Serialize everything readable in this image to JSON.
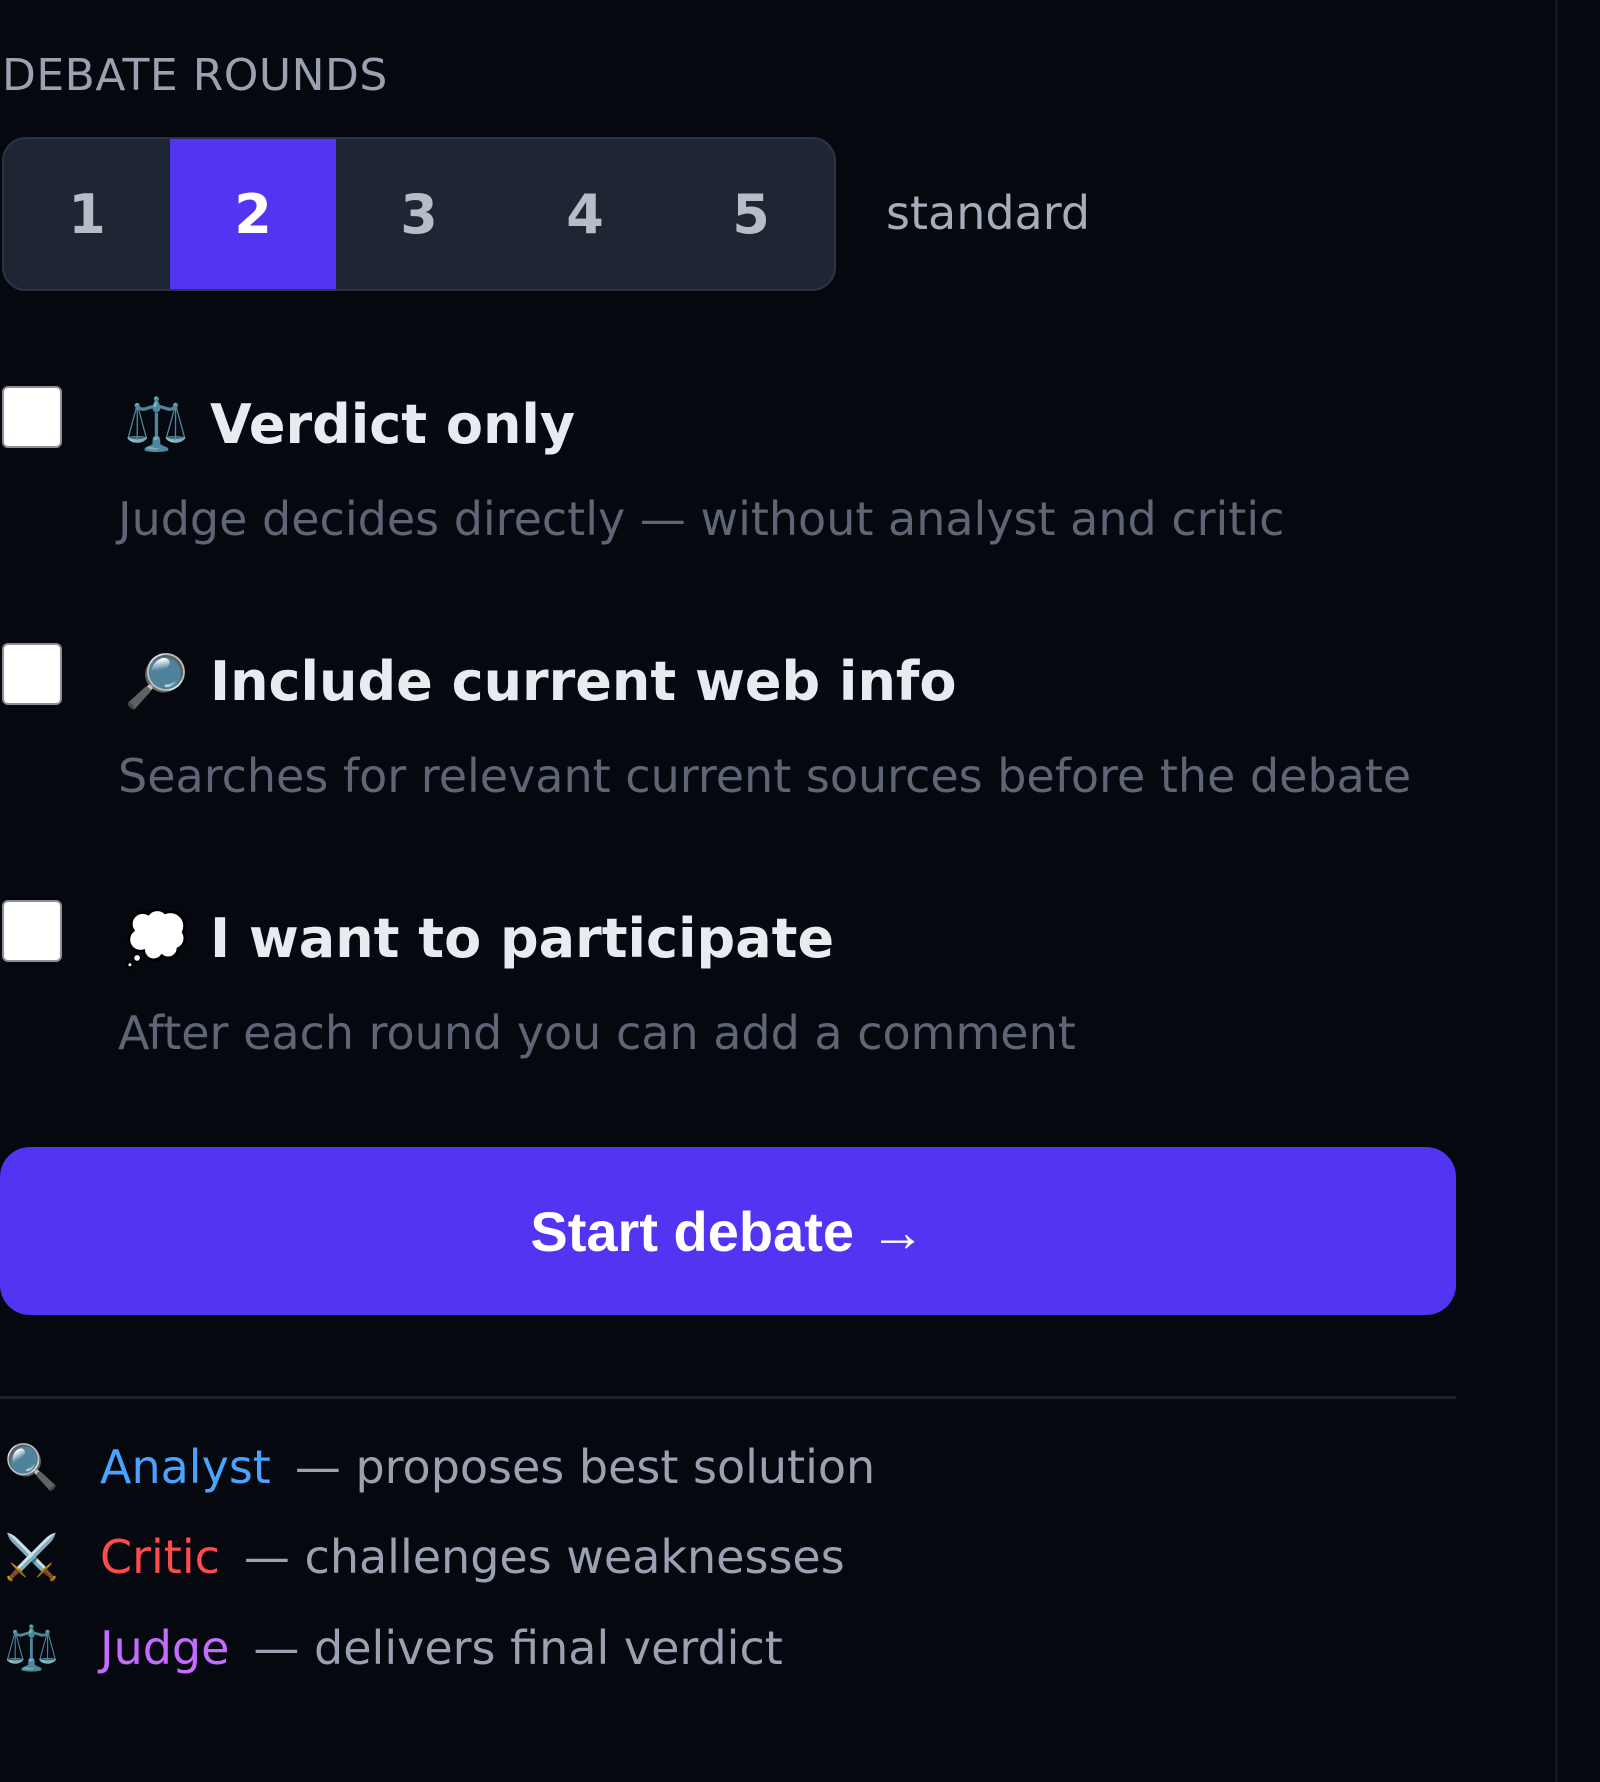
{
  "rounds": {
    "title": "DEBATE ROUNDS",
    "options": [
      "1",
      "2",
      "3",
      "4",
      "5"
    ],
    "selected": "2",
    "hint": "standard"
  },
  "options": [
    {
      "icon": "⚖️",
      "icon_name": "scales-icon",
      "label": "Verdict only",
      "description": "Judge decides directly — without analyst and critic",
      "checked": false
    },
    {
      "icon": "🔎",
      "icon_name": "magnifier-icon",
      "label": "Include current web info",
      "description": "Searches for relevant current sources before the debate",
      "checked": false
    },
    {
      "icon": "💭",
      "icon_name": "thought-bubble-icon",
      "label": "I want to participate",
      "description": "After each round you can add a comment",
      "checked": false
    }
  ],
  "start_button": {
    "label": "Start debate →"
  },
  "roles": [
    {
      "icon": "🔍",
      "icon_name": "magnifier-icon",
      "name": "Analyst",
      "description": "— proposes best solution",
      "color": "#4aa3ff"
    },
    {
      "icon": "⚔️",
      "icon_name": "crossed-swords-icon",
      "name": "Critic",
      "description": "— challenges weaknesses",
      "color": "#ff4b4b"
    },
    {
      "icon": "⚖️",
      "icon_name": "scales-icon",
      "name": "Judge",
      "description": "— delivers final verdict",
      "color": "#c56bff"
    }
  ],
  "colors": {
    "accent": "#5135f3",
    "background": "#05080f"
  }
}
